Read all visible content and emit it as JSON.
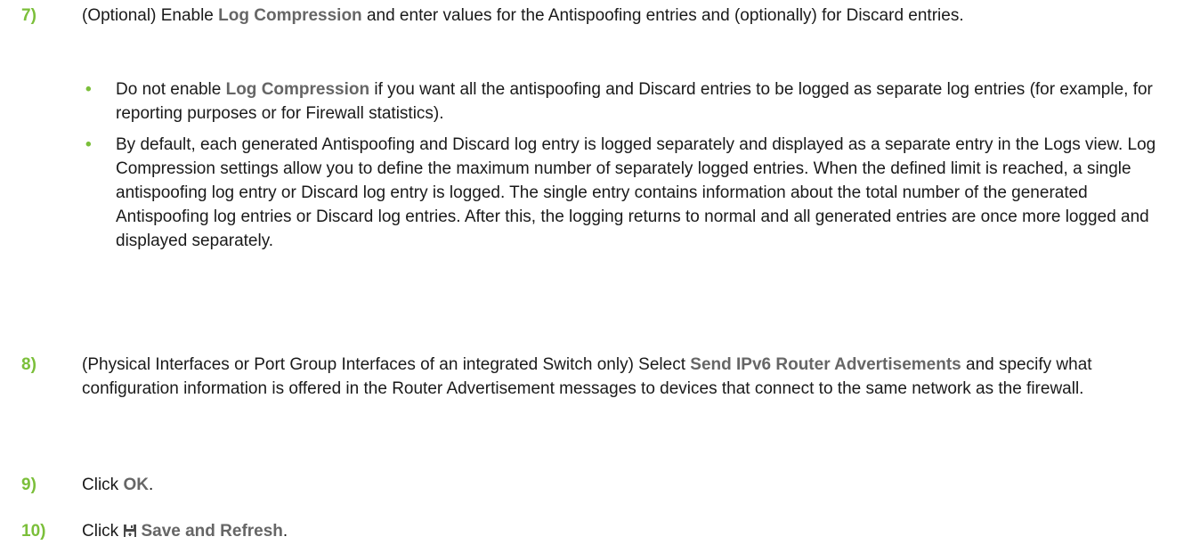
{
  "steps": [
    {
      "number": "7)",
      "text_1": "(Optional) Enable ",
      "ui_1": "Log Compression",
      "text_2": " and enter values for the Antispoofing entries and (optionally) for Discard entries.",
      "bullets": [
        {
          "text_1": "Do not enable ",
          "ui_1": "Log Compression",
          "text_2": " if you want all the antispoofing and Discard entries to be logged as separate log entries (for example, for reporting purposes or for Firewall statistics)."
        },
        {
          "text": "By default, each generated Antispoofing and Discard log entry is logged separately and displayed as a separate entry in the Logs view. Log Compression settings allow you to define the maximum number of separately logged entries. When the defined limit is reached, a single antispoofing log entry or Discard log entry is logged. The single entry contains information about the total number of the generated Antispoofing log entries or Discard log entries. After this, the logging returns to normal and all generated entries are once more logged and displayed separately."
        }
      ]
    },
    {
      "number": "8)",
      "text_1": "(Physical Interfaces or Port Group Interfaces of an integrated Switch only) Select ",
      "ui_1": "Send IPv6 Router Advertisements",
      "text_2": " and specify what configuration information is offered in the Router Advertisement messages to devices that connect to the same network as the firewall."
    },
    {
      "number": "9)",
      "text_1": "Click ",
      "ui_1": "OK",
      "text_2": "."
    },
    {
      "number": "10)",
      "text_1": "Click ",
      "icon": "save-icon",
      "ui_1": "Save and Refresh",
      "text_2": "."
    }
  ],
  "bullet_glyph": "•",
  "colors": {
    "accent_green": "#7bbf3a",
    "ui_gray": "#666666",
    "text": "#1a1a1a"
  }
}
